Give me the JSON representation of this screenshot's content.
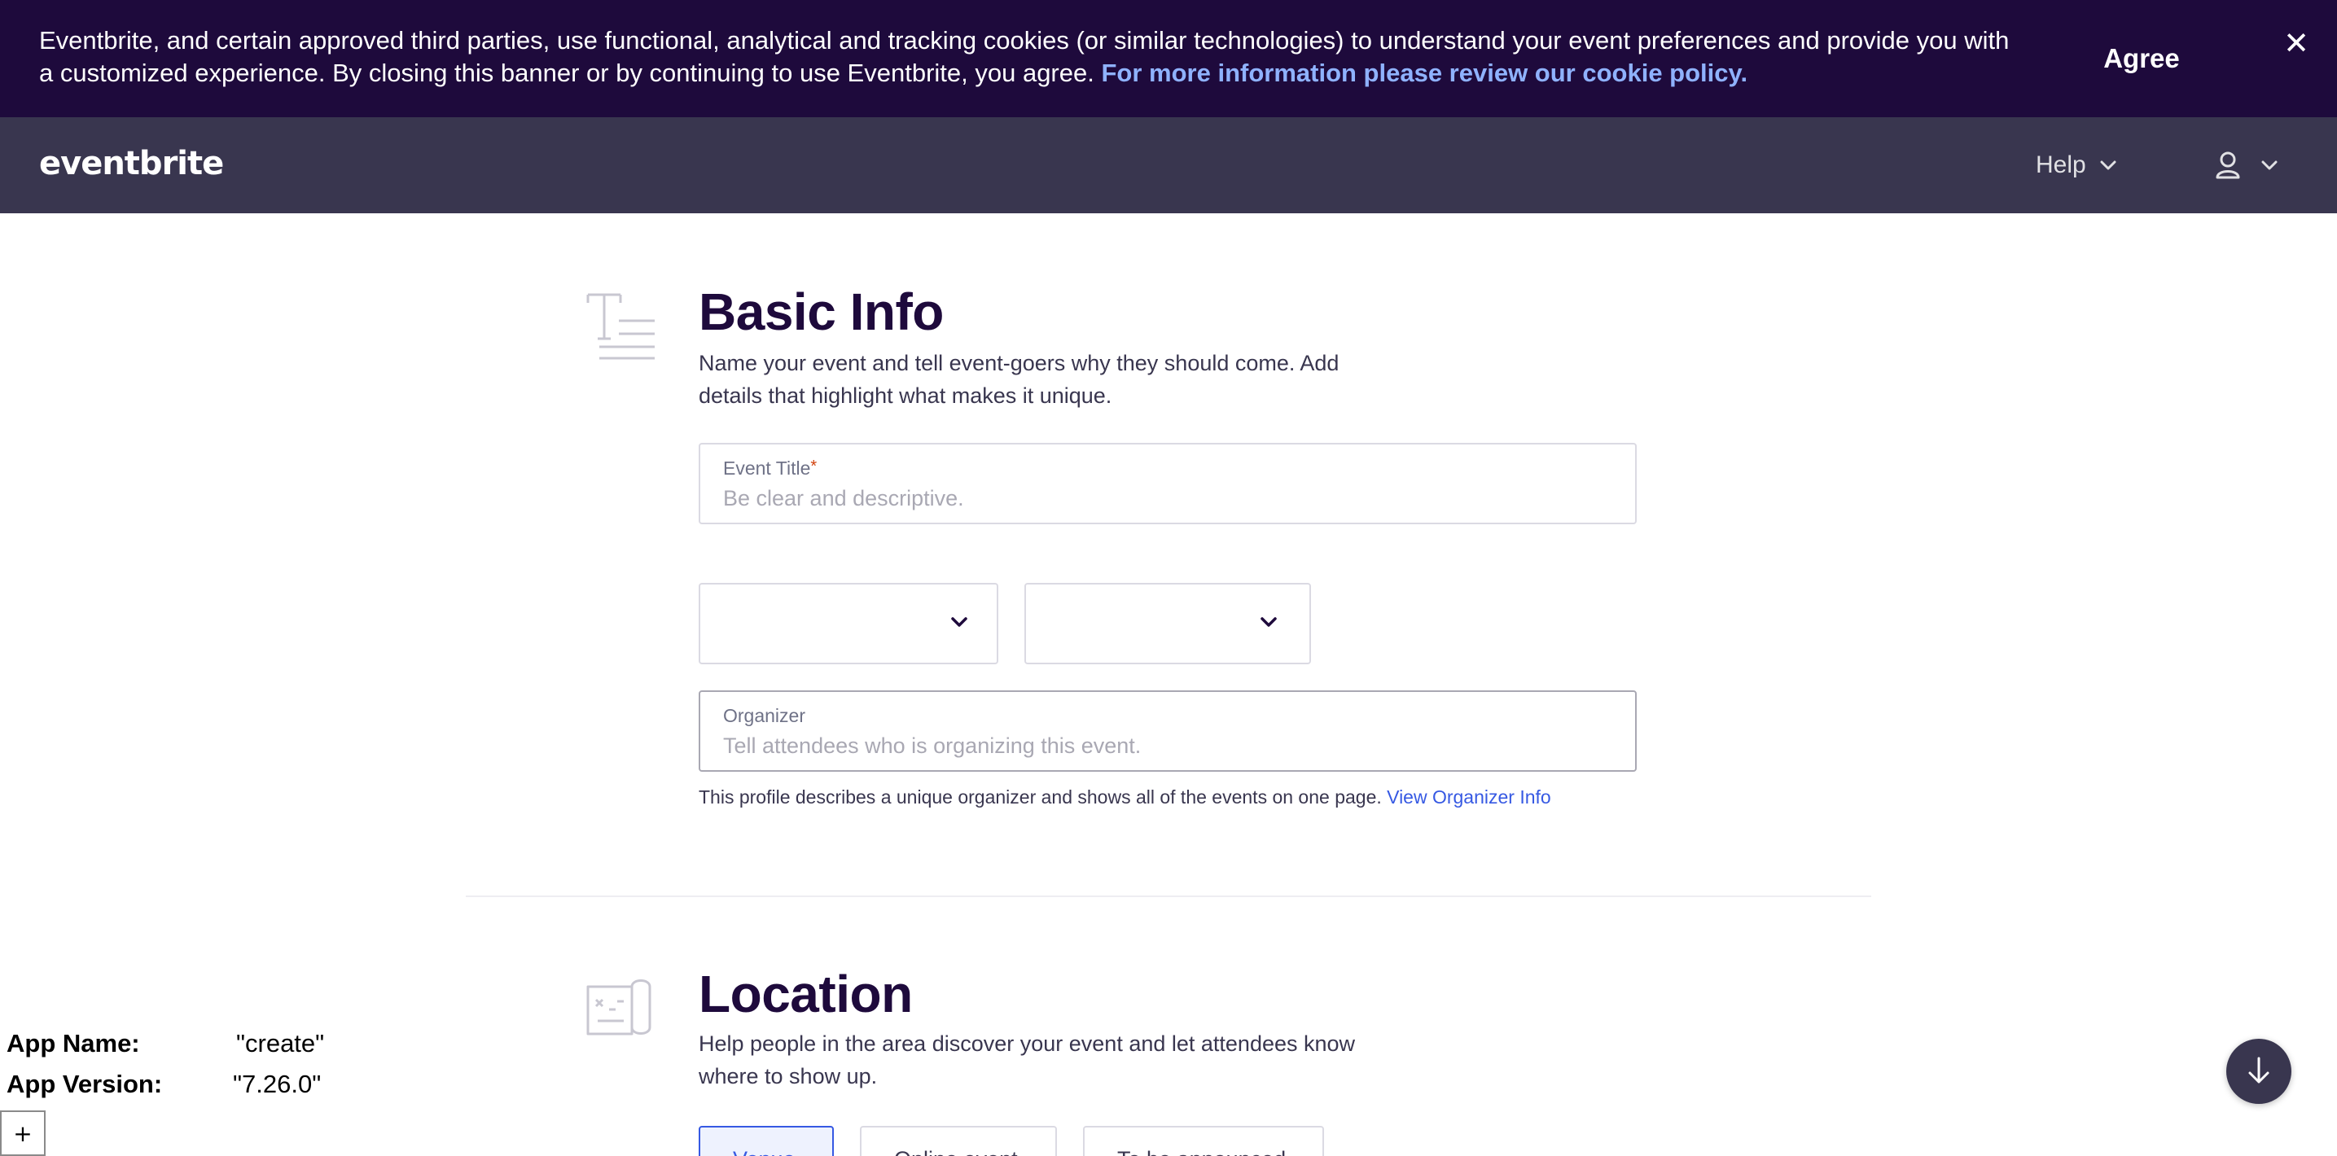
{
  "cookie_banner": {
    "text": "Eventbrite, and certain approved third parties, use functional, analytical and tracking cookies (or similar technologies) to understand your event preferences and provide you with a customized experience. By closing this banner or by continuing to use Eventbrite, you agree.",
    "link_text": "For more information please review our cookie policy.",
    "agree_label": "Agree",
    "close_symbol": "✕"
  },
  "header": {
    "logo": "eventbrite",
    "help_label": "Help",
    "account_icon": "user-icon"
  },
  "basic_info": {
    "title": "Basic Info",
    "description": "Name your event and tell event-goers why they should come. Add details that highlight what makes it unique.",
    "event_title": {
      "label": "Event Title",
      "required_mark": "*",
      "value": "",
      "placeholder": "Be clear and descriptive."
    },
    "organizer": {
      "label": "Organizer",
      "value": "",
      "placeholder": "Tell attendees who is organizing this event."
    },
    "organizer_helper": "This profile describes a unique organizer and shows all of the events on one page.",
    "organizer_link": "View Organizer Info"
  },
  "location": {
    "title": "Location",
    "description": "Help people in the area discover your event and let attendees know where to show up.",
    "options": [
      "Venue",
      "Online event",
      "To be announced"
    ]
  },
  "app_info": {
    "name_label": "App Name:",
    "name_value": "\"create\"",
    "version_label": "App Version:",
    "version_value": "\"7.26.0\""
  },
  "plus_label": "+",
  "colors": {
    "banner_bg": "#1e0a3c",
    "nav_bg": "#39364f",
    "link_blue": "#3659e3",
    "banner_link": "#8fb2ff",
    "required": "#d1410c"
  }
}
